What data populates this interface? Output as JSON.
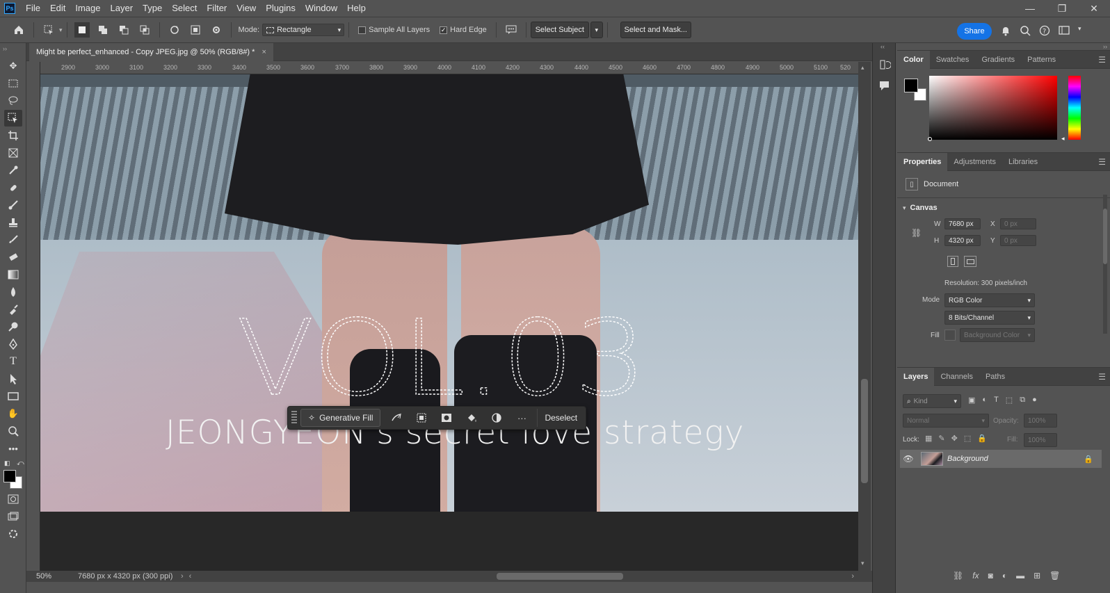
{
  "app": {
    "logo": "Ps"
  },
  "menu": [
    "File",
    "Edit",
    "Image",
    "Layer",
    "Type",
    "Select",
    "Filter",
    "View",
    "Plugins",
    "Window",
    "Help"
  ],
  "window_controls": [
    "—",
    "❐",
    "✕"
  ],
  "options": {
    "mode_label": "Mode:",
    "mode_value": "Rectangle",
    "sample_all_layers": "Sample All Layers",
    "hard_edge": "Hard Edge",
    "select_subject": "Select Subject",
    "select_and_mask": "Select and Mask...",
    "share": "Share"
  },
  "document": {
    "tab_title": "Might be perfect_enhanced - Copy JPEG.jpg @ 50% (RGB/8#) *",
    "zoom": "50%",
    "status_info": "7680 px x 4320 px (300 ppi)",
    "ruler_ticks": [
      "2900",
      "3000",
      "3100",
      "3200",
      "3300",
      "3400",
      "3500",
      "3600",
      "3700",
      "3800",
      "3900",
      "4000",
      "4100",
      "4200",
      "4300",
      "4400",
      "4500",
      "4600",
      "4700",
      "4800",
      "4900",
      "5000",
      "5100",
      "520"
    ]
  },
  "artwork": {
    "vol_text": "VOL.03",
    "subtitle": "JEONGYEON's secret love strategy"
  },
  "context_bar": {
    "generative_fill": "Generative Fill",
    "deselect": "Deselect",
    "more": "···"
  },
  "color_panel": {
    "tabs": [
      "Color",
      "Swatches",
      "Gradients",
      "Patterns"
    ],
    "hue_color": "#ff0000"
  },
  "properties_panel": {
    "tabs": [
      "Properties",
      "Adjustments",
      "Libraries"
    ],
    "doc_label": "Document",
    "canvas_label": "Canvas",
    "w_label": "W",
    "w_value": "7680 px",
    "h_label": "H",
    "h_value": "4320 px",
    "x_label": "X",
    "x_value": "0 px",
    "y_label": "Y",
    "y_value": "0 px",
    "resolution": "Resolution: 300 pixels/inch",
    "mode_label": "Mode",
    "mode_value": "RGB Color",
    "bits_value": "8 Bits/Channel",
    "fill_label": "Fill",
    "fill_value": "Background Color"
  },
  "layers_panel": {
    "tabs": [
      "Layers",
      "Channels",
      "Paths"
    ],
    "kind_placeholder": "Kind",
    "blend_mode": "Normal",
    "opacity_label": "Opacity:",
    "opacity_value": "100%",
    "lock_label": "Lock:",
    "fill_label": "Fill:",
    "fill_value": "100%",
    "layers": [
      {
        "name": "Background",
        "visible": true,
        "locked": true
      }
    ]
  }
}
